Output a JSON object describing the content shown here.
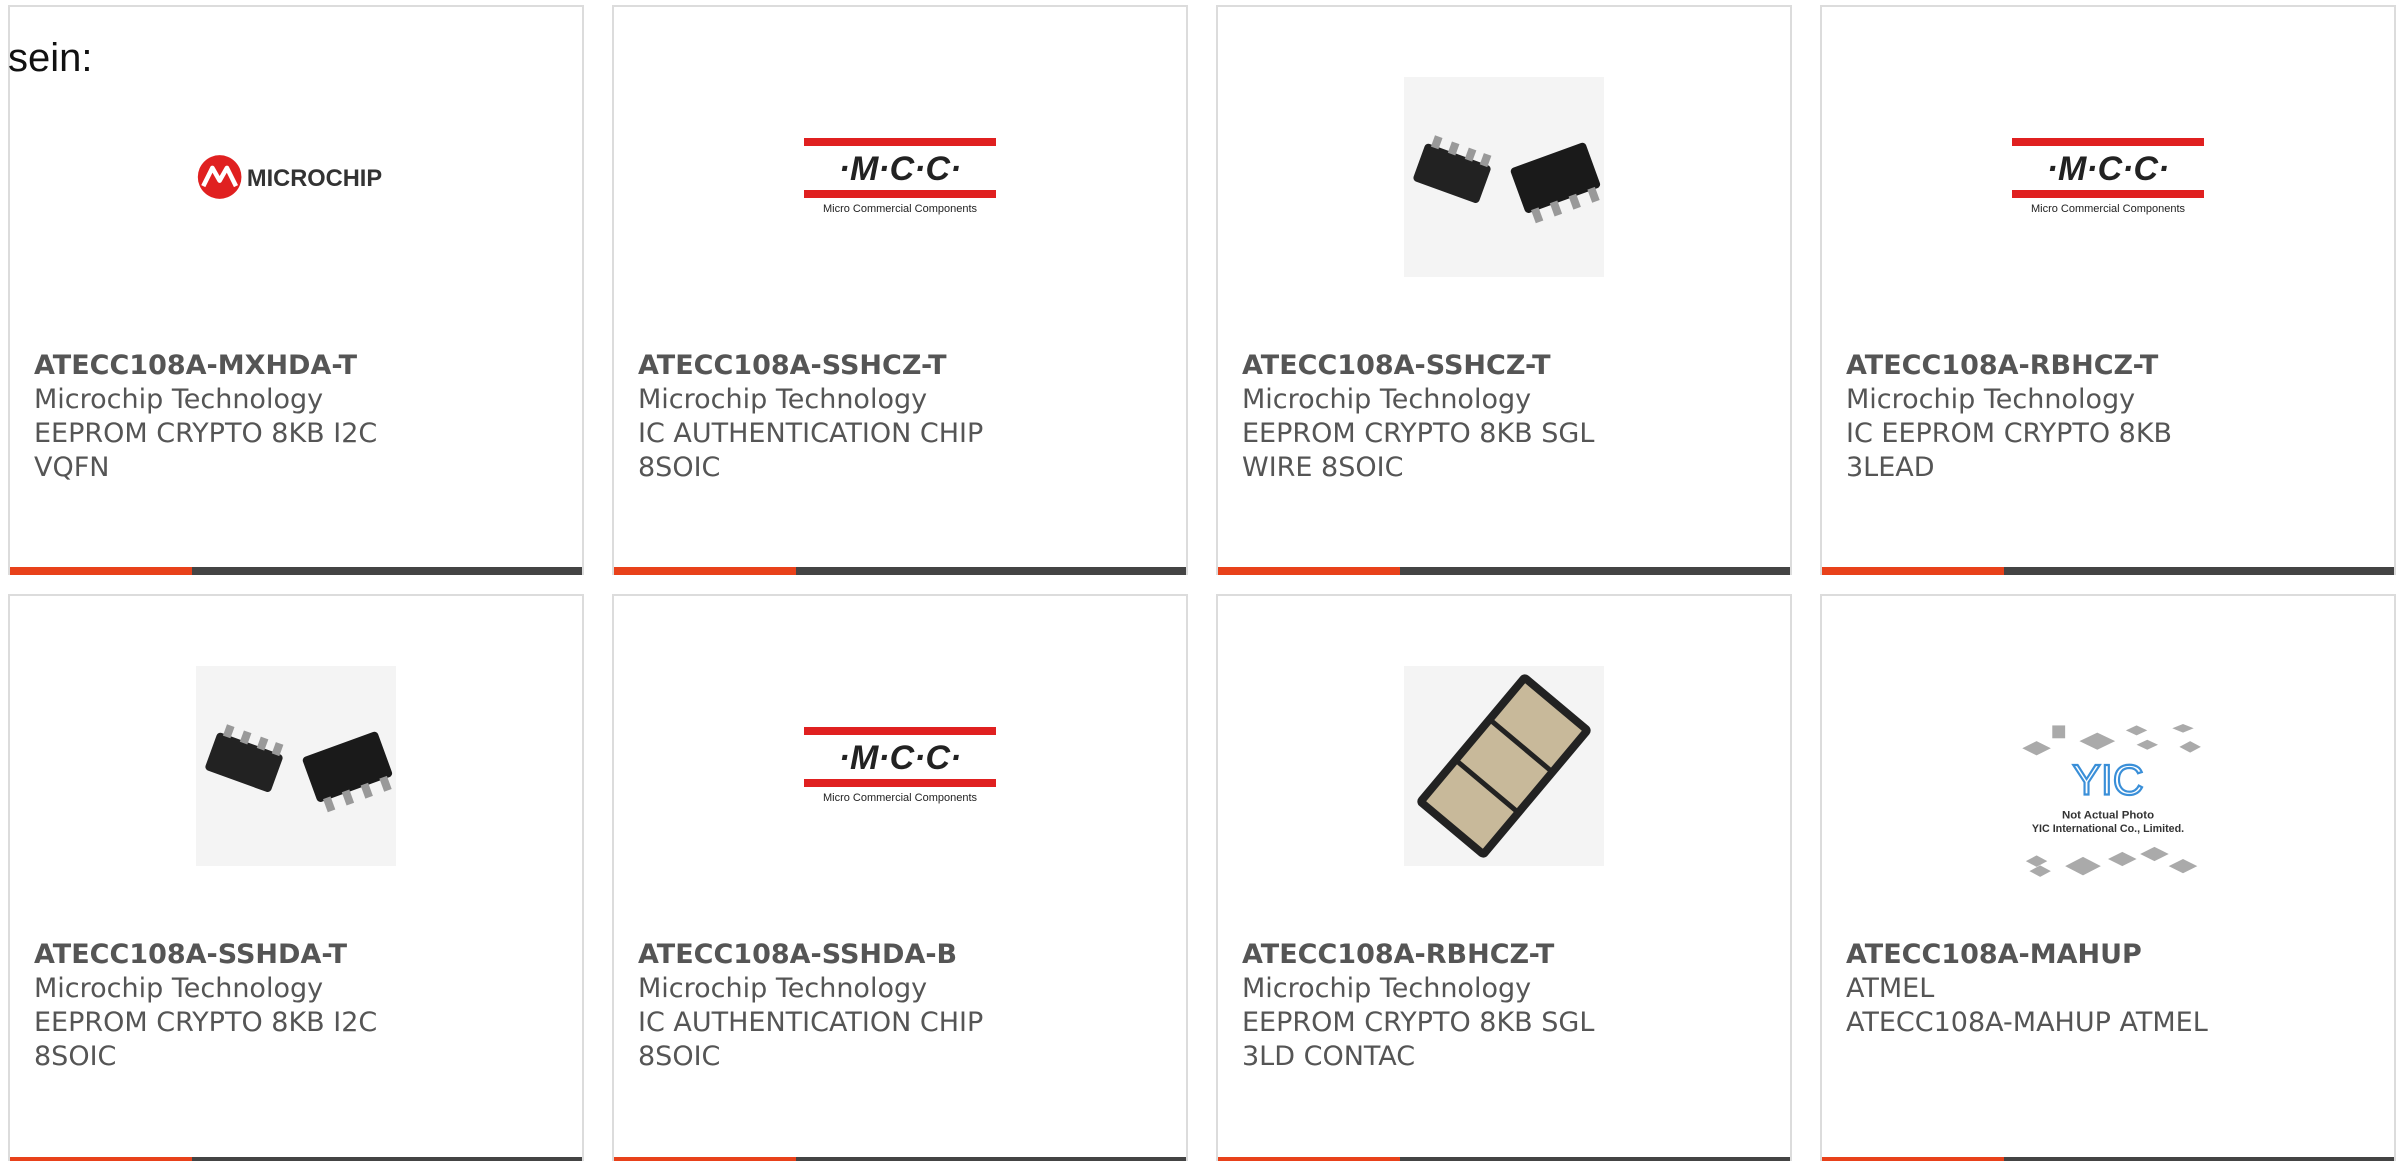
{
  "intro": {
    "text": "sein:"
  },
  "colors": {
    "accent": "#e8411a",
    "bar": "#444444",
    "border": "#dcdcdc",
    "text": "#555555"
  },
  "products": [
    {
      "part": "ATECC108A-MXHDA-T",
      "manufacturer": "Microchip Technology",
      "description": "EEPROM CRYPTO 8KB I2C VQFN",
      "image": "microchip-logo",
      "logo_text": "MICROCHIP"
    },
    {
      "part": "ATECC108A-SSHCZ-T",
      "manufacturer": "Microchip Technology",
      "description": "IC AUTHENTICATION CHIP 8SOIC",
      "image": "mcc-logo",
      "logo_text": "·M·C·C·",
      "logo_sub": "Micro Commercial Components"
    },
    {
      "part": "ATECC108A-SSHCZ-T",
      "manufacturer": "Microchip Technology",
      "description": "EEPROM CRYPTO 8KB SGL WIRE 8SOIC",
      "image": "soic-chip-photo"
    },
    {
      "part": "ATECC108A-RBHCZ-T",
      "manufacturer": "Microchip Technology",
      "description": "IC EEPROM CRYPTO 8KB 3LEAD",
      "image": "mcc-logo",
      "logo_text": "·M·C·C·",
      "logo_sub": "Micro Commercial Components"
    },
    {
      "part": "ATECC108A-SSHDA-T",
      "manufacturer": "Microchip Technology",
      "description": "EEPROM CRYPTO 8KB I2C 8SOIC",
      "image": "soic-chip-photo"
    },
    {
      "part": "ATECC108A-SSHDA-B",
      "manufacturer": "Microchip Technology",
      "description": "IC AUTHENTICATION CHIP 8SOIC",
      "image": "mcc-logo",
      "logo_text": "·M·C·C·",
      "logo_sub": "Micro Commercial Components"
    },
    {
      "part": "ATECC108A-RBHCZ-T",
      "manufacturer": "Microchip Technology",
      "description": "EEPROM CRYPTO 8KB SGL 3LD CONTAC",
      "image": "contact-package-photo"
    },
    {
      "part": "ATECC108A-MAHUP",
      "manufacturer": "ATMEL",
      "description": "ATECC108A-MAHUP ATMEL",
      "image": "yic-placeholder",
      "logo_text": "YIC",
      "photo_note_1": "Not Actual Photo",
      "photo_note_2": "YIC International Co., Limited."
    }
  ]
}
